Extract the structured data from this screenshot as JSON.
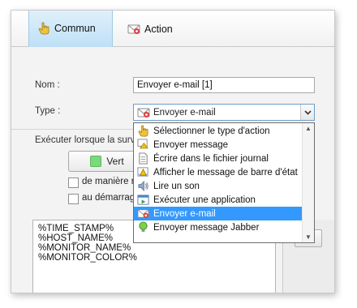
{
  "tabs": [
    {
      "label": "Commun",
      "icon": "hand-pointer-icon",
      "active": true
    },
    {
      "label": "Action",
      "icon": "email-icon",
      "active": false
    }
  ],
  "form": {
    "name_label": "Nom :",
    "name_value": "Envoyer e-mail [1]",
    "type_label": "Type :",
    "type_value": "Envoyer e-mail",
    "execute_label": "Exécuter lorsque la surve",
    "color_button_label": "Vert",
    "color_swatch": "#7ad97a",
    "checkbox1_label": "de manière ré",
    "checkbox2_label": "au démarrage"
  },
  "dropdown": {
    "items": [
      {
        "label": "Sélectionner le type d'action",
        "icon": "hand-pointer-icon"
      },
      {
        "label": "Envoyer message",
        "icon": "message-warning-icon"
      },
      {
        "label": "Écrire dans le fichier journal",
        "icon": "log-file-icon"
      },
      {
        "label": "Afficher le message de barre d'état",
        "icon": "statusbar-warning-icon"
      },
      {
        "label": "Lire un son",
        "icon": "speaker-icon"
      },
      {
        "label": "Exécuter une application",
        "icon": "application-icon"
      },
      {
        "label": "Envoyer e-mail",
        "icon": "email-icon",
        "selected": true
      },
      {
        "label": "Envoyer message Jabber",
        "icon": "jabber-bulb-icon"
      }
    ],
    "selected_color": "#3399ff"
  },
  "variables": [
    "%TIME_STAMP%",
    "%HOST_NAME%",
    "%MONITOR_NAME%",
    "%MONITOR_COLOR%"
  ]
}
